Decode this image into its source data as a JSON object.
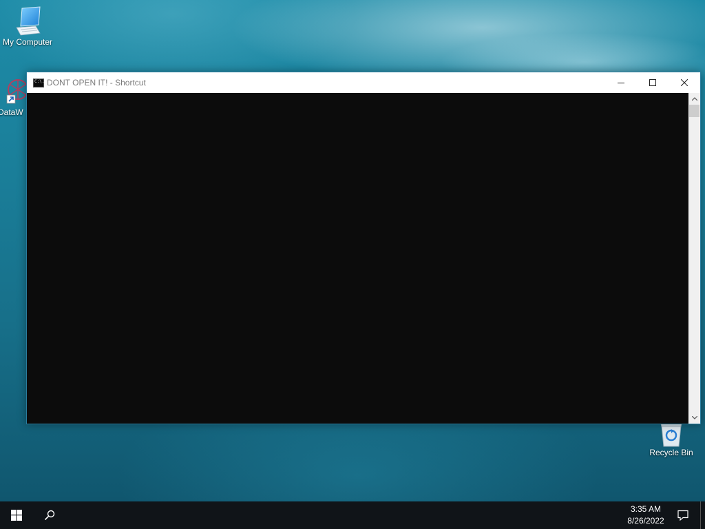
{
  "desktop": {
    "icons": [
      {
        "label": "My Computer",
        "icon": "computer-icon"
      },
      {
        "label": "DataW",
        "icon": "network-shortcut-icon"
      },
      {
        "label": "Recycle Bin",
        "icon": "recycle-bin-icon"
      }
    ]
  },
  "window": {
    "title": "DONT OPEN IT! - Shortcut",
    "app_icon": "cmd-icon",
    "app_icon_text": "C:\\.",
    "buttons": {
      "minimize": "minimize-icon",
      "maximize": "maximize-icon",
      "close": "close-icon"
    },
    "console_background": "#0c0c0c"
  },
  "taskbar": {
    "start_icon": "windows-logo-icon",
    "search_icon": "search-icon",
    "time": "3:35 AM",
    "date": "8/26/2022",
    "notification_icon": "notification-icon"
  }
}
